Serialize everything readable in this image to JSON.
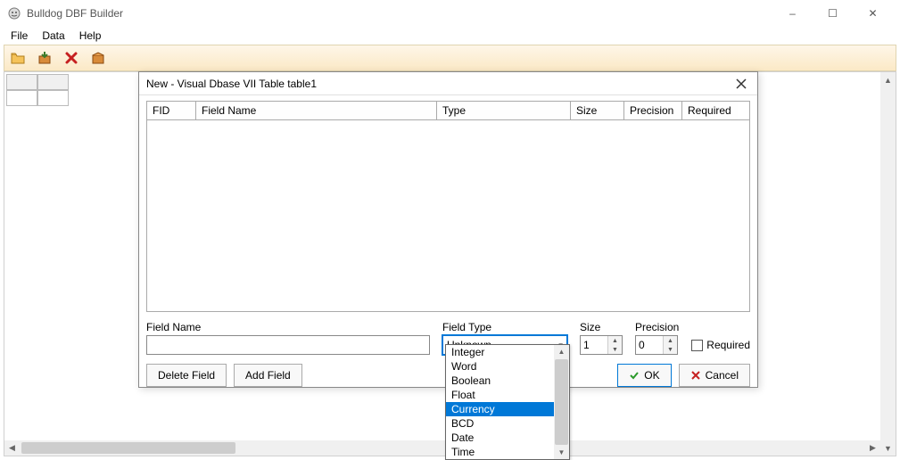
{
  "app": {
    "title": "Bulldog DBF Builder"
  },
  "menus": [
    "File",
    "Data",
    "Help"
  ],
  "toolbar_icons": [
    "open-folder-icon",
    "package-down-icon",
    "delete-x-icon",
    "export-box-icon"
  ],
  "window_controls": {
    "min": "–",
    "max": "☐",
    "close": "✕"
  },
  "dialog": {
    "title": "New - Visual Dbase VII Table table1",
    "columns": [
      "FID",
      "Field Name",
      "Type",
      "Size",
      "Precision",
      "Required"
    ],
    "labels": {
      "field_name": "Field Name",
      "field_type": "Field Type",
      "size": "Size",
      "precision": "Precision",
      "required": "Required"
    },
    "values": {
      "field_name": "",
      "field_type_selected": "Unknown",
      "size": "1",
      "precision": "0",
      "required_checked": false
    },
    "buttons": {
      "delete_field": "Delete Field",
      "add_field": "Add Field",
      "ok": "OK",
      "cancel": "Cancel"
    },
    "dropdown_options": [
      "Integer",
      "Word",
      "Boolean",
      "Float",
      "Currency",
      "BCD",
      "Date",
      "Time"
    ],
    "dropdown_highlight": "Currency"
  }
}
